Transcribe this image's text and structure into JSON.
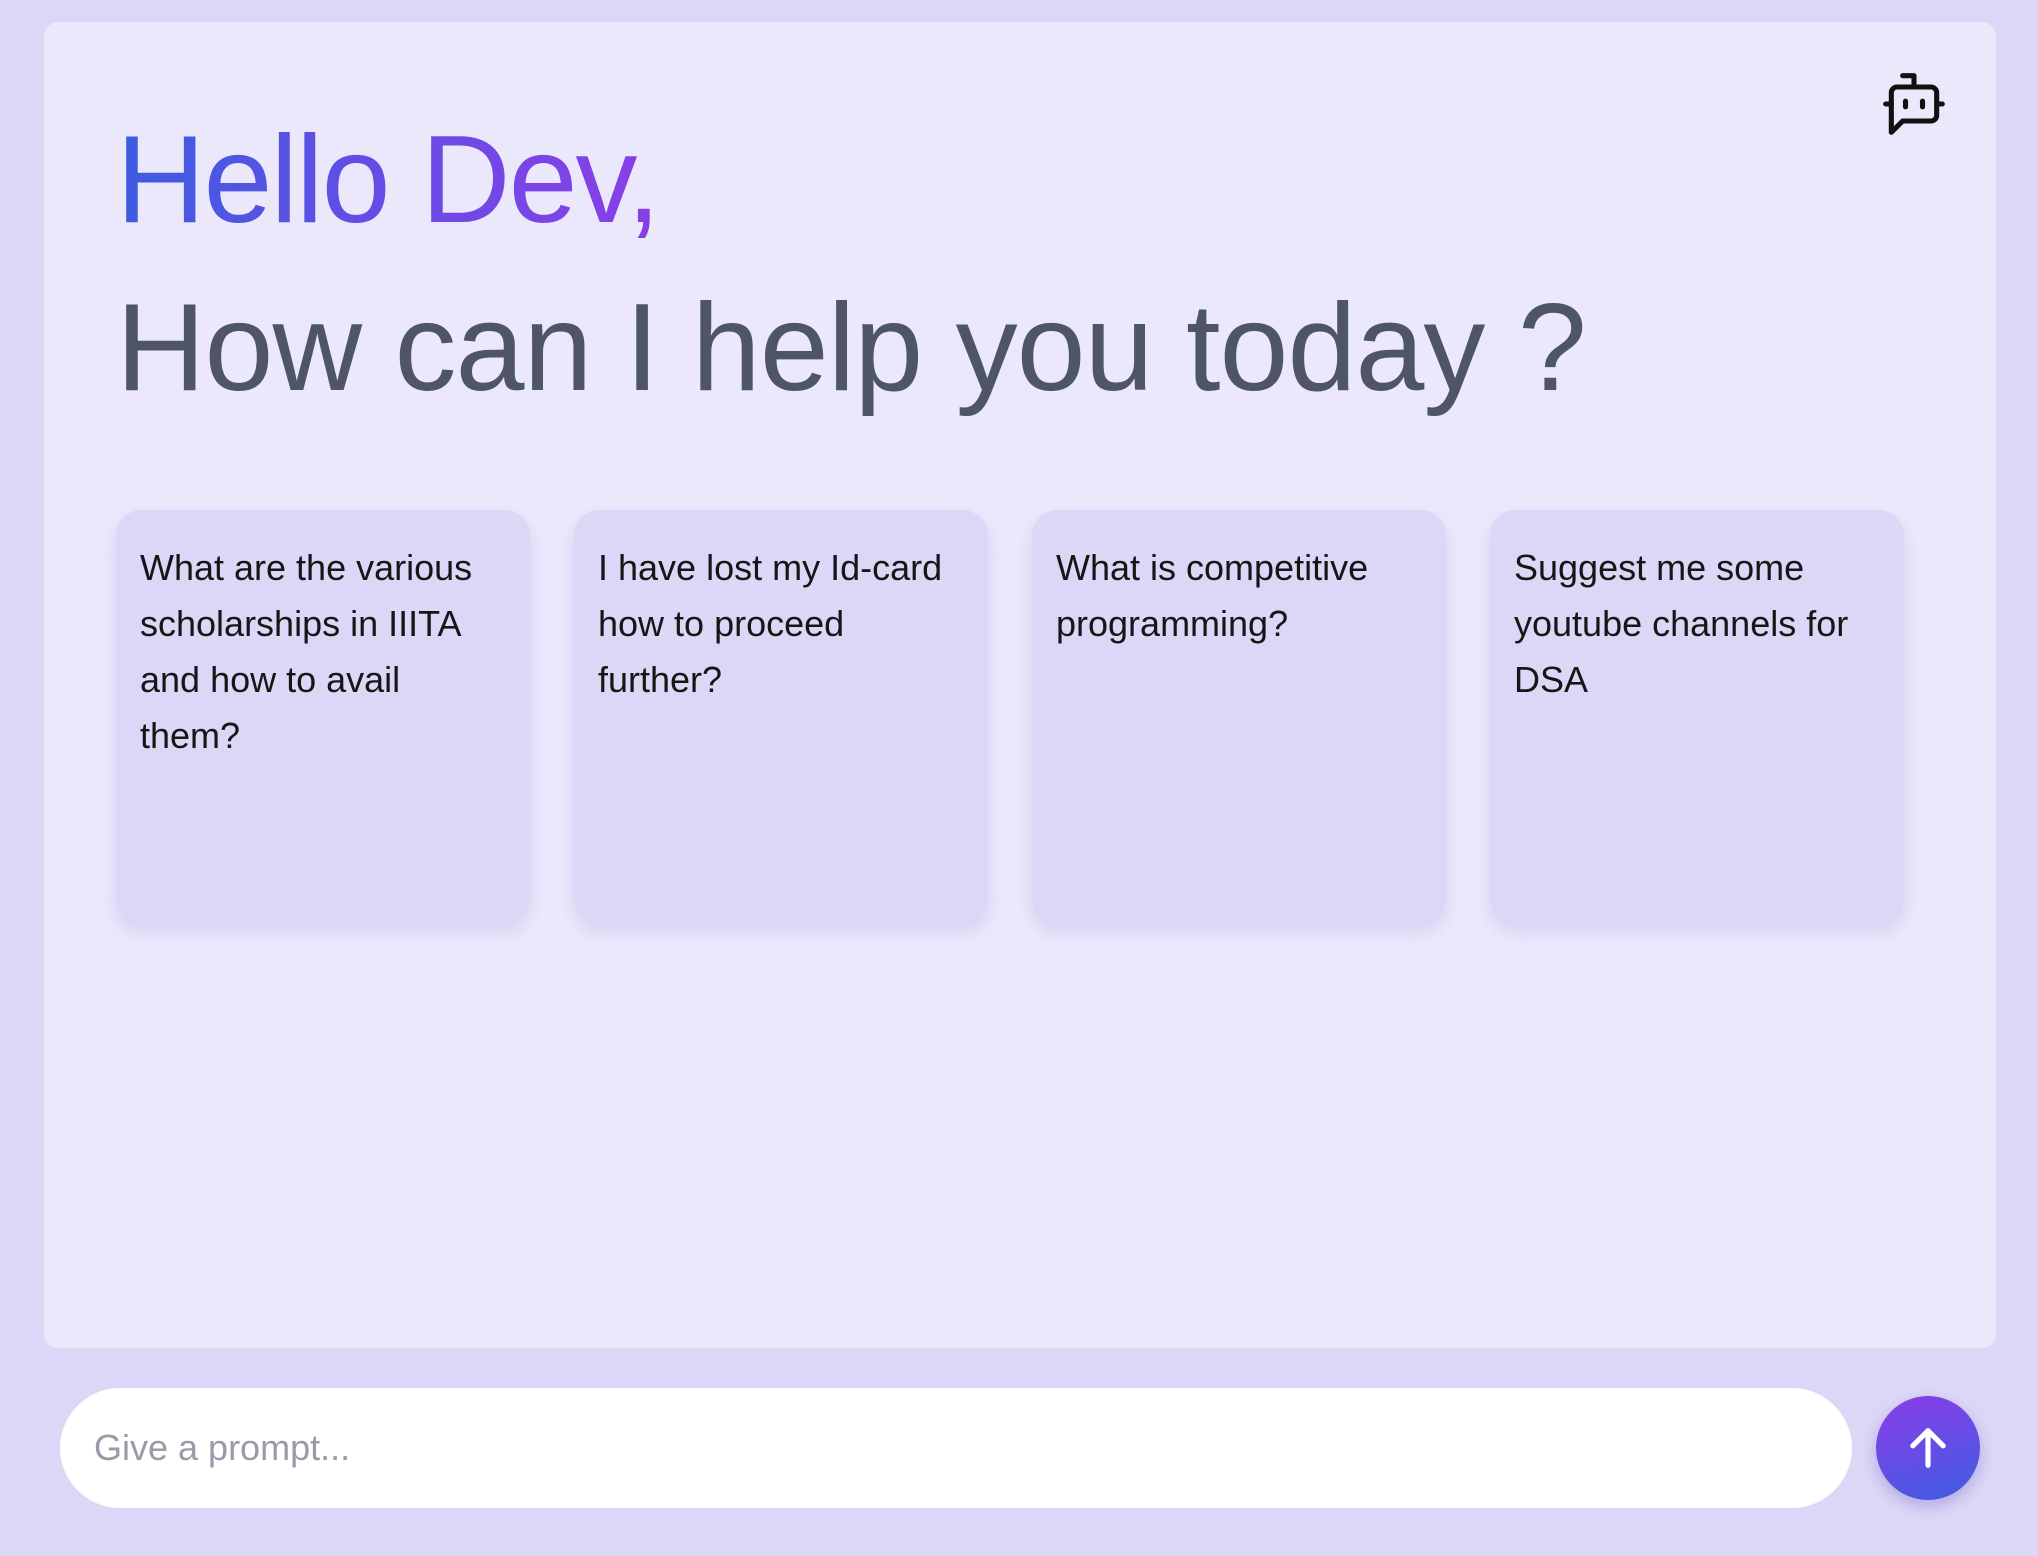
{
  "header": {
    "greeting": "Hello Dev,",
    "subtitle": "How can I help you today ?",
    "bot_icon": "bot-message-icon"
  },
  "suggestions": [
    {
      "text": "What are the various scholarships in IIITA and how to avail them?"
    },
    {
      "text": "I have lost my Id-card how to proceed further?"
    },
    {
      "text": "What is competitive programming?"
    },
    {
      "text": "Suggest me some youtube channels for DSA"
    }
  ],
  "prompt": {
    "placeholder": "Give a prompt...",
    "value": "",
    "send_icon": "arrow-up-icon"
  },
  "colors": {
    "background": "#dcd6f7",
    "panel": "#ece8fc",
    "card": "#dcd6f7",
    "gradient_start": "#3d5ce0",
    "gradient_end": "#8a3ee6",
    "subtitle_text": "#4d5566"
  }
}
